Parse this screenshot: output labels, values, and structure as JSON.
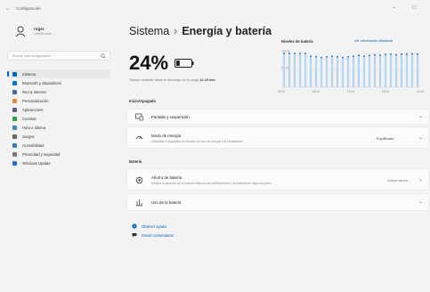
{
  "window": {
    "app_title": "Configuración",
    "back_glyph": "←",
    "minimize_glyph": "–",
    "maximize_glyph": "□"
  },
  "user": {
    "name": "roger",
    "account": "Cuenta local"
  },
  "search": {
    "placeholder": "Buscar una configuración"
  },
  "sidebar": {
    "items": [
      {
        "label": "Sistema",
        "icon": "monitor-icon",
        "color": "#0067c0",
        "active": true
      },
      {
        "label": "Bluetooth y dispositivos",
        "icon": "bluetooth-icon",
        "color": "#0078d4"
      },
      {
        "label": "Red & internet",
        "icon": "network-icon",
        "color": "#3a6ea5"
      },
      {
        "label": "Personalización",
        "icon": "brush-icon",
        "color": "#e3893b"
      },
      {
        "label": "Aplicaciones",
        "icon": "apps-icon",
        "color": "#5c5c8a"
      },
      {
        "label": "Cuentas",
        "icon": "person-icon",
        "color": "#2ea043"
      },
      {
        "label": "Hora e idioma",
        "icon": "globe-icon",
        "color": "#3a86c8"
      },
      {
        "label": "Juegos",
        "icon": "gamepad-icon",
        "color": "#666666"
      },
      {
        "label": "Accesibilidad",
        "icon": "accessibility-icon",
        "color": "#2f7fbf"
      },
      {
        "label": "Privacidad y seguridad",
        "icon": "shield-icon",
        "color": "#7a7a7a"
      },
      {
        "label": "Windows Update",
        "icon": "update-icon",
        "color": "#1f6fd1"
      }
    ]
  },
  "header": {
    "section": "Sistema",
    "separator": "›",
    "current": "Energía y batería"
  },
  "battery": {
    "percent": "24%",
    "level": 0.24,
    "status_prefix": "Tiempo restante hasta la descarga de la carga",
    "status_value": "1h 15 min"
  },
  "levels": {
    "title": "Niveles de batería",
    "link": "Ver información detallada"
  },
  "chart_data": {
    "type": "area",
    "title": "Niveles de batería",
    "ylim": [
      0,
      100
    ],
    "y_ticks": [
      "100 %",
      "50 %"
    ],
    "x": [
      "00:00",
      "06:00",
      "12:00",
      "18:00",
      "24:00"
    ],
    "series": [
      {
        "values": [
          100,
          100,
          100,
          100,
          100,
          92,
          90,
          88,
          90,
          92,
          90,
          88,
          90,
          92,
          94,
          92,
          94,
          96,
          95,
          97,
          98,
          96,
          98,
          98,
          99,
          98
        ]
      }
    ]
  },
  "power": {
    "section_label": "Inicio/Apagado",
    "screen_sleep": {
      "title": "Pantalla y suspensión",
      "icon": "display-icon"
    },
    "power_mode": {
      "title": "Modo de energía",
      "subtitle": "Optimizar el dispositivo en función del uso de energía y el rendimiento",
      "value": "Equilibrado",
      "icon": "power-mode-icon"
    }
  },
  "battery_section": {
    "label": "Batería",
    "saver": {
      "title": "Ahorro de batería",
      "subtitle": "Ampliar la duración de la batería limitando las notificaciones y la actividad en segundo plano",
      "value": "Activar ahora",
      "icon": "battery-saver-icon"
    },
    "usage": {
      "title": "Uso de la batería",
      "icon": "usage-icon"
    }
  },
  "help": [
    {
      "label": "Obtener ayuda",
      "icon": "help-icon"
    },
    {
      "label": "Enviar comentarios",
      "icon": "feedback-icon"
    }
  ]
}
